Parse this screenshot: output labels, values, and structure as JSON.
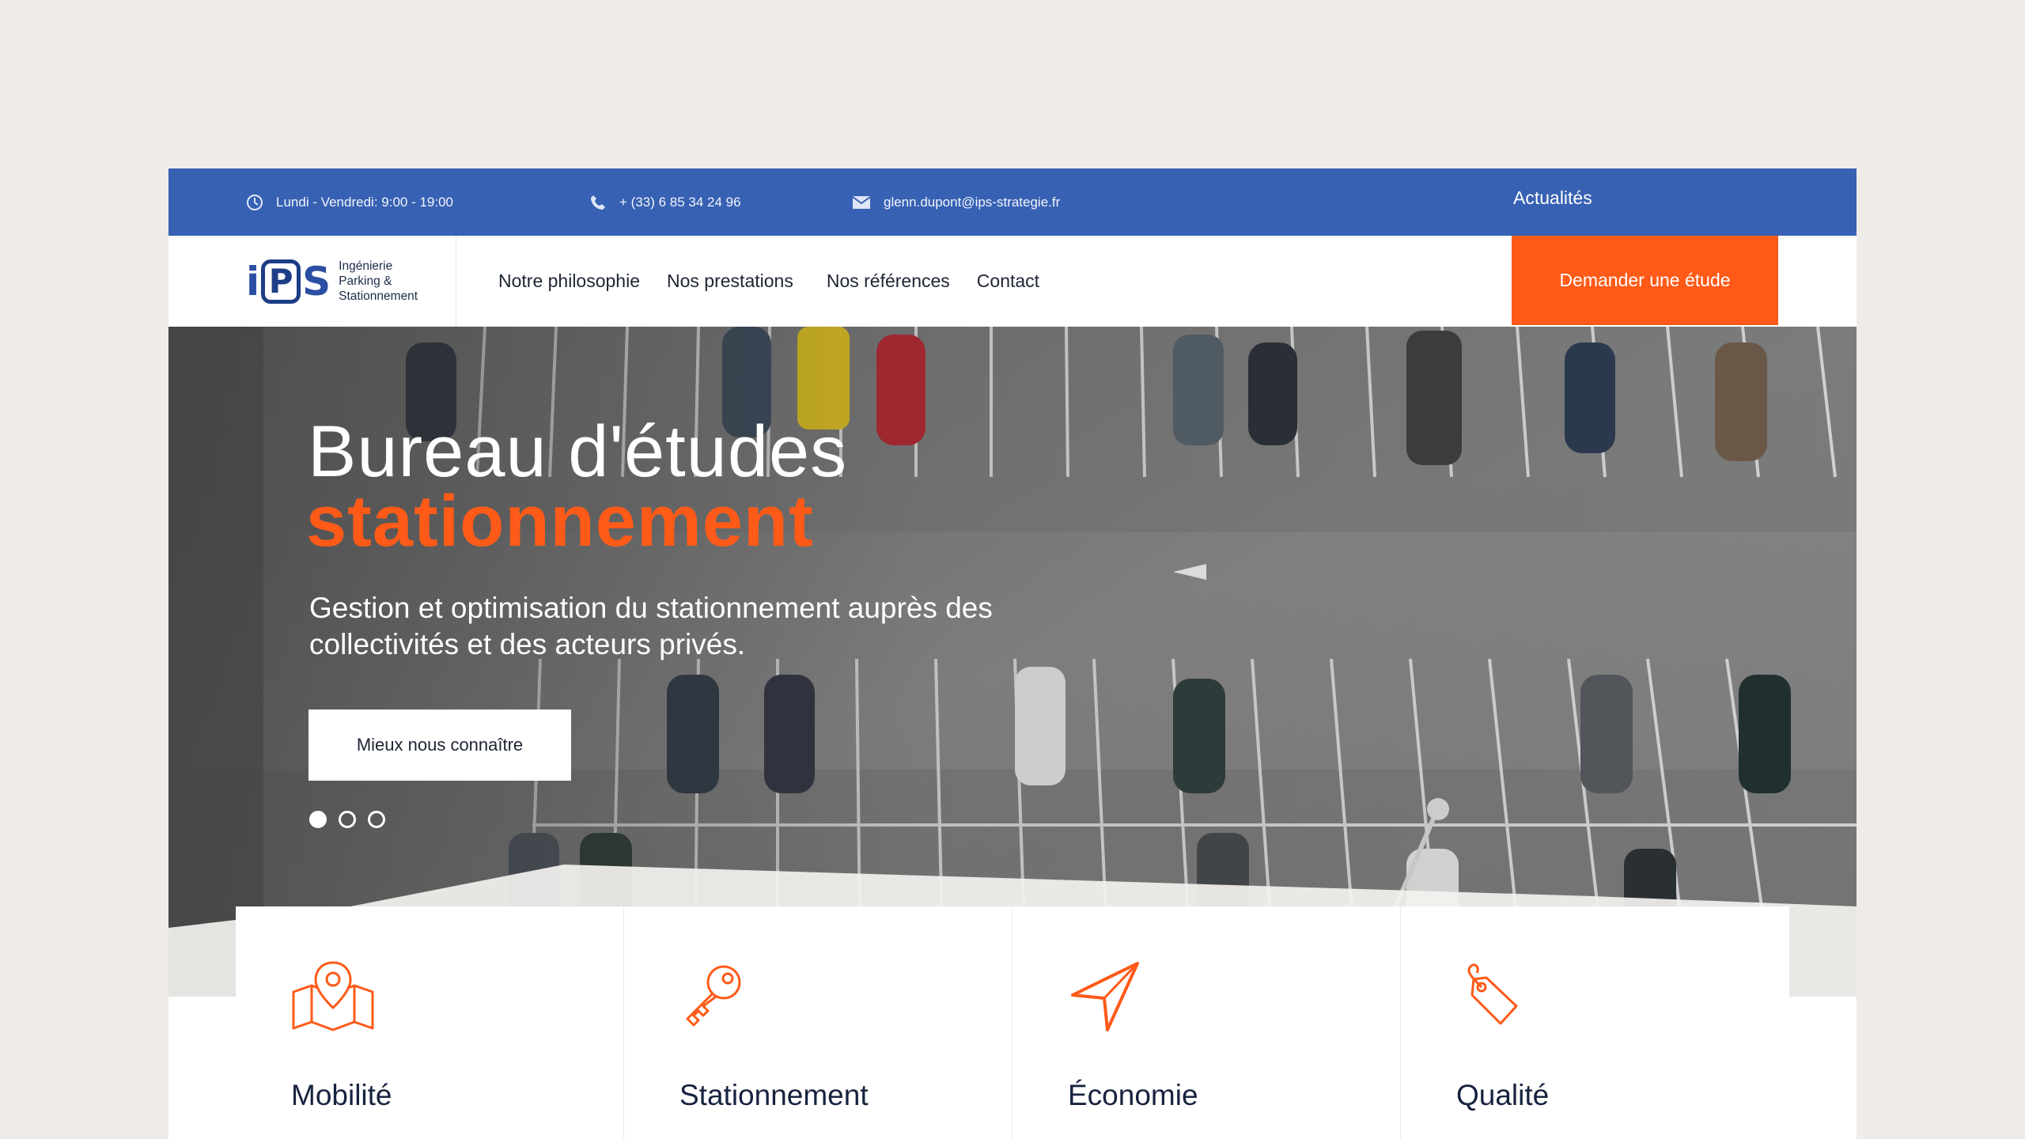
{
  "topbar": {
    "hours": "Lundi - Vendredi: 9:00 - 19:00",
    "phone": "+ (33) 6 85 34 24 96",
    "email": "glenn.dupont@ips-strategie.fr",
    "news_link": "Actualités"
  },
  "logo": {
    "mark_i": "i",
    "mark_p": "P",
    "mark_s": "S",
    "line1": "Ingénierie",
    "line2": "Parking &",
    "line3": "Stationnement"
  },
  "nav": {
    "items": [
      {
        "label": "Notre philosophie"
      },
      {
        "label": "Nos prestations"
      },
      {
        "label": "Nos références"
      },
      {
        "label": "Contact"
      }
    ],
    "cta_label": "Demander une étude"
  },
  "hero": {
    "title_line1": "Bureau d'études",
    "title_line2": "stationnement",
    "subtitle": "Gestion et optimisation du stationnement auprès des collectivités et des acteurs privés.",
    "button_label": "Mieux nous connaître",
    "slides_total": 3,
    "active_slide": 1
  },
  "features": [
    {
      "title": "Mobilité",
      "icon": "map-pin-icon"
    },
    {
      "title": "Stationnement",
      "icon": "key-icon"
    },
    {
      "title": "Économie",
      "icon": "navigation-arrow-icon"
    },
    {
      "title": "Qualité",
      "icon": "price-tag-icon"
    }
  ],
  "colors": {
    "primary_blue": "#3761b3",
    "accent_orange": "#ff5a18",
    "page_bg": "#efebe8",
    "text_dark": "#17233f"
  }
}
